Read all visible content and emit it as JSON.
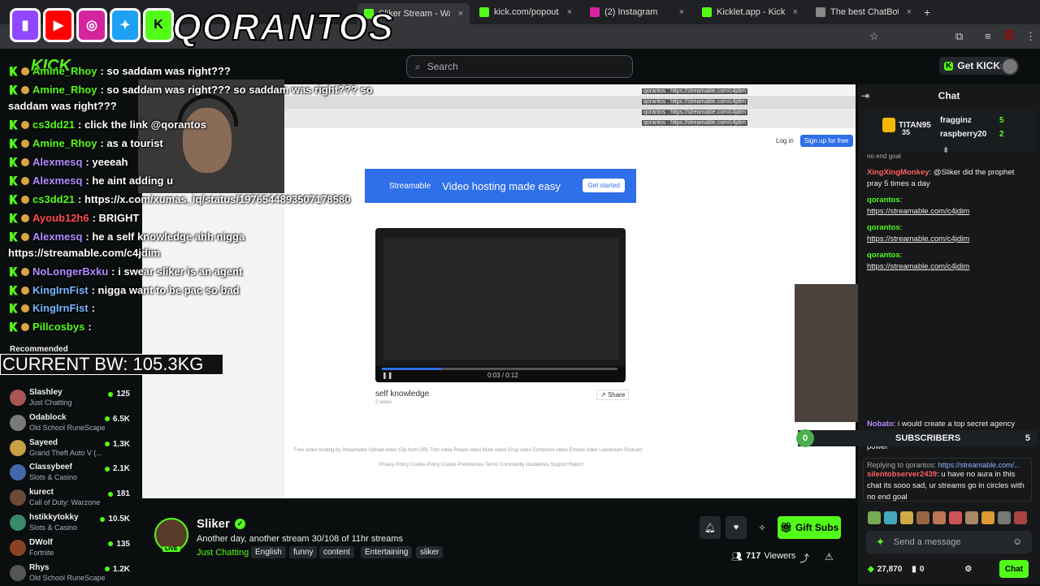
{
  "browser": {
    "tabs": [
      {
        "label": "Sliker Stream - Watch",
        "color": "#53fc18",
        "active": true
      },
      {
        "label": "kick.com/popout/qorantos",
        "color": "#53fc18",
        "active": false
      },
      {
        "label": "(2) Instagram",
        "color": "#d6249f",
        "active": false
      },
      {
        "label": "Kicklet.app - Kick Chatbo",
        "color": "#53fc18",
        "active": false
      },
      {
        "label": "The best ChatBot and W",
        "color": "#888888",
        "active": false
      }
    ]
  },
  "overlay": {
    "brand": "QORANTOS",
    "logos": [
      "twitch",
      "youtube",
      "instagram",
      "twitter",
      "kick"
    ],
    "bw_text": "CURRENT BW: 105.3KG",
    "chat": [
      {
        "user": "Amine_Rhoy",
        "text": ": so saddam was right???",
        "color": "#53fc18"
      },
      {
        "user": "Amine_Rhoy",
        "text": ": so saddam was right??? so saddam was right??? so",
        "color": "#53fc18"
      },
      {
        "wrap": "saddam was right???"
      },
      {
        "user": "cs3dd21",
        "text": ": click the link @qorantos",
        "color": "#53fc18"
      },
      {
        "user": "Amine_Rhoy",
        "text": ": as a tourist",
        "color": "#53fc18"
      },
      {
        "user": "Alexmesq",
        "text": ": yeeeah",
        "color": "#b48cff"
      },
      {
        "user": "Alexmesq",
        "text": ": he aint adding u",
        "color": "#b48cff"
      },
      {
        "user": "cs3dd21",
        "text": ": https://x.com/xumas_iq/status/1976544893507178580",
        "color": "#53fc18"
      },
      {
        "user": "Ayoub12h6",
        "text": ": BRIGHT",
        "color": "#ff4d4d"
      },
      {
        "user": "Alexmesq",
        "text": ": he a self knowledge ahh nigga",
        "color": "#b48cff"
      },
      {
        "wrap": "https://streamable.com/c4jdim"
      },
      {
        "user": "NoLongerBxku",
        "text": ": i swear sliker is an agent",
        "color": "#b48cff"
      },
      {
        "user": "KingIrnFist",
        "text": ": nigga want to be pac so bad",
        "color": "#7ab8ff"
      },
      {
        "user": "KingIrnFist",
        "text": ":",
        "color": "#7ab8ff"
      },
      {
        "user": "Pillcosbys",
        "text": ":",
        "color": "#53fc18"
      }
    ]
  },
  "header": {
    "search_placeholder": "Search",
    "get_kicks": "Get KICKs"
  },
  "sidebar": {
    "recommended_label": "Recommended",
    "items": [
      {
        "name": "Slashley",
        "category": "Just Chatting",
        "viewers": "125",
        "color": "#a55"
      },
      {
        "name": "Odablock",
        "category": "Old School RuneScape",
        "viewers": "6.5K",
        "color": "#7a7a7a"
      },
      {
        "name": "Sayeed",
        "category": "Grand Theft Auto V (...",
        "viewers": "1.3K",
        "color": "#c9a042"
      },
      {
        "name": "Classybeef",
        "category": "Slots & Casino",
        "viewers": "2.1K",
        "color": "#4466aa"
      },
      {
        "name": "kurect",
        "category": "Call of Duty: Warzone",
        "viewers": "181",
        "color": "#6b4a36"
      },
      {
        "name": "hstikkytokky",
        "category": "Slots & Casino",
        "viewers": "10.5K",
        "color": "#3a8a6a"
      },
      {
        "name": "DWolf",
        "category": "Fortnite",
        "viewers": "135",
        "color": "#884422"
      },
      {
        "name": "Rhys",
        "category": "Old School RuneScape",
        "viewers": "1.2K",
        "color": "#555555"
      }
    ]
  },
  "video": {
    "banner_brand": "Streamable",
    "banner_tagline": "Video hosting made easy",
    "banner_button": "Get started",
    "login": "Log in",
    "signup": "Sign up for free",
    "player_time": "0:03 / 0:12",
    "progress": 0.25,
    "caption": "self knowledge",
    "caption_sub": "2 views",
    "share": "Share",
    "footer1": "Free video hosting by Streamable    Upload video    Clip from URL    Trim video    Rotate video    Mute video    Crop video    Compress video    Embed video    Livestream    Podcast",
    "footer2": "Privacy Policy    Cookie Policy    Cookie Preferences    Terms    Community Guidelines    Support    Report",
    "inner_chat": [
      "qorantos : https://streamable.com/c4jdim",
      "qorantos : https://streamable.com/c4jdim",
      "qorantos : https://streamable.com/c4jdim",
      "qorantos : https://streamable.com/c4jdim"
    ]
  },
  "stream": {
    "streamer": "Sliker",
    "live": "LIVE",
    "title": "Another day, another stream 30/108 of 11hr streams",
    "category": "Just Chatting",
    "tags": [
      "English",
      "funny",
      "content",
      "Entertaining",
      "sliker"
    ],
    "gift_subs": "Gift Subs",
    "viewers": "717",
    "viewers_label": "Viewers"
  },
  "chat": {
    "title": "Chat",
    "gifters": [
      {
        "name": "TITAN95",
        "count": "35"
      },
      {
        "name": "fragginz",
        "count": "5"
      },
      {
        "name": "raspberry20",
        "count": "2"
      }
    ],
    "pinned_tail": "no end goal",
    "messages": [
      {
        "user": "XingXingMonkey",
        "text": ": @Sliker did the prophet pray 5 times a day",
        "color": "#ff5f5f"
      },
      {
        "user": "qorantos",
        "text": ":",
        "link": "https://streamable.com/c4jdim",
        "color": "#53fc18"
      },
      {
        "user": "qorantos",
        "text": ":",
        "link": "https://streamable.com/c4jdim",
        "color": "#53fc18"
      },
      {
        "user": "qorantos",
        "text": ":",
        "link": "https://streamable.com/c4jdim",
        "color": "#53fc18"
      },
      {
        "user": "Nobato",
        "text": ": i would create a top secret agency called ... and eliminate all the gay lovers in power",
        "color": "#b48cff"
      }
    ],
    "subs_count_left": "0",
    "subs_label": "SUBSCRIBERS",
    "subs_count_right": "5",
    "reply_prefix": "Replying to qorantos:",
    "reply_link": "https://streamable.com/...",
    "reply_user": "silentobserver2439",
    "reply_text": ": u have no aura in this chat its sooo sad, ur streams go in circles with no end goal",
    "input_placeholder": "Send a message",
    "kicks": "27,870",
    "subs_small": "0",
    "send": "Chat"
  }
}
